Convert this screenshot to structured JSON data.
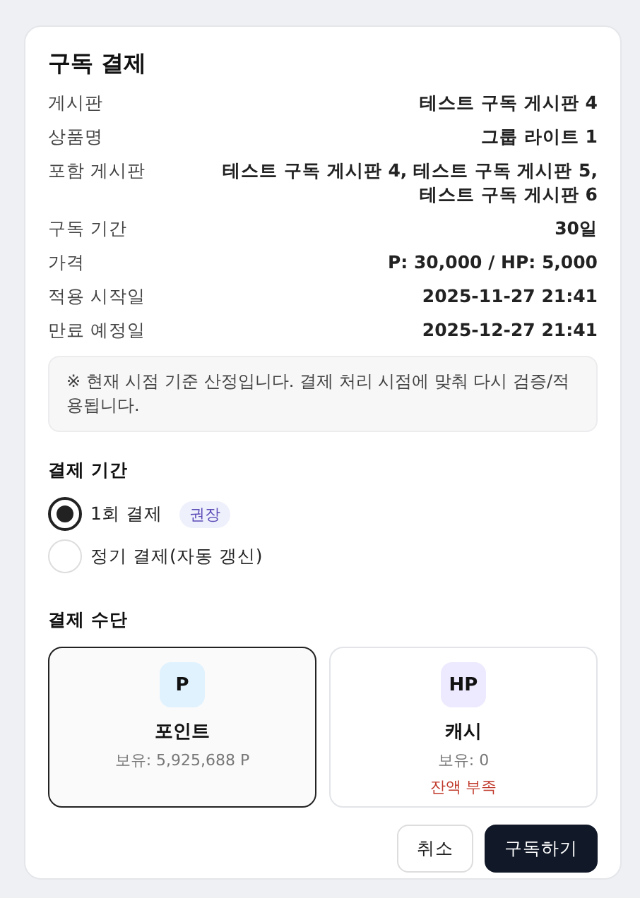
{
  "dialog": {
    "title": "구독 결제"
  },
  "details": [
    {
      "label": "게시판",
      "value": "테스트 구독 게시판 4"
    },
    {
      "label": "상품명",
      "value": "그룹 라이트 1"
    },
    {
      "label": "포함 게시판",
      "value": "테스트 구독 게시판 4, 테스트 구독 게시판 5, 테스트 구독 게시판 6"
    },
    {
      "label": "구독 기간",
      "value": "30일"
    },
    {
      "label": "가격",
      "value": "P: 30,000  /  HP: 5,000"
    },
    {
      "label": "적용 시작일",
      "value": "2025-11-27 21:41"
    },
    {
      "label": "만료 예정일",
      "value": "2025-12-27 21:41"
    }
  ],
  "notice": "※ 현재 시점 기준 산정입니다. 결제 처리 시점에 맞춰 다시 검증/적용됩니다.",
  "period": {
    "heading": "결제 기간",
    "options": [
      {
        "label": "1회 결제",
        "badge": "권장",
        "selected": true
      },
      {
        "label": "정기 결제(자동 갱신)",
        "selected": false
      }
    ]
  },
  "method": {
    "heading": "결제 수단",
    "options": [
      {
        "symbol": "P",
        "name": "포인트",
        "balance": "보유: 5,925,688 P",
        "color": "#e0f2fe",
        "selected": true
      },
      {
        "symbol": "HP",
        "name": "캐시",
        "balance": "보유: 0",
        "warning": "잔액 부족",
        "color": "#ede9fe",
        "selected": false
      }
    ]
  },
  "buttons": [
    {
      "label": "취소",
      "kind": "secondary"
    },
    {
      "label": "구독하기",
      "kind": "primary"
    }
  ]
}
